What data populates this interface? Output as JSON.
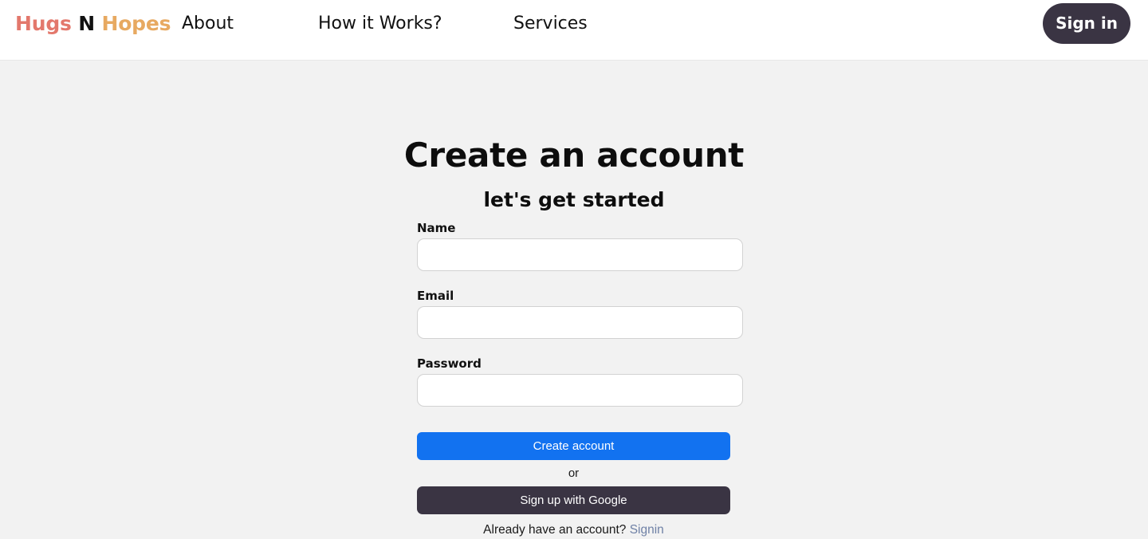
{
  "header": {
    "brand": {
      "part1": "Hugs",
      "part2": "N",
      "part3": "Hopes",
      "color1": "#e3786c",
      "color2": "#111111",
      "color3": "#e7a961"
    },
    "nav": [
      {
        "label": "About"
      },
      {
        "label": "How it Works?"
      },
      {
        "label": "Services"
      }
    ],
    "signin_button": "Sign in",
    "signin_button_color": "#3a3443",
    "background": "#ffffff"
  },
  "main": {
    "title": "Create an account",
    "subtitle": "let's get started",
    "background": "#f2f2f2",
    "form": {
      "fields": [
        {
          "label": "Name",
          "value": "",
          "placeholder": ""
        },
        {
          "label": "Email",
          "value": "",
          "placeholder": ""
        },
        {
          "label": "Password",
          "value": "",
          "placeholder": ""
        }
      ],
      "submit_label": "Create account",
      "submit_color": "#1272f0",
      "divider_text": "or",
      "google_label": "Sign up with Google",
      "google_color": "#3a3443",
      "footer_text": "Already have an account?",
      "footer_link": "Signin",
      "footer_link_color": "#6f81a6"
    }
  }
}
